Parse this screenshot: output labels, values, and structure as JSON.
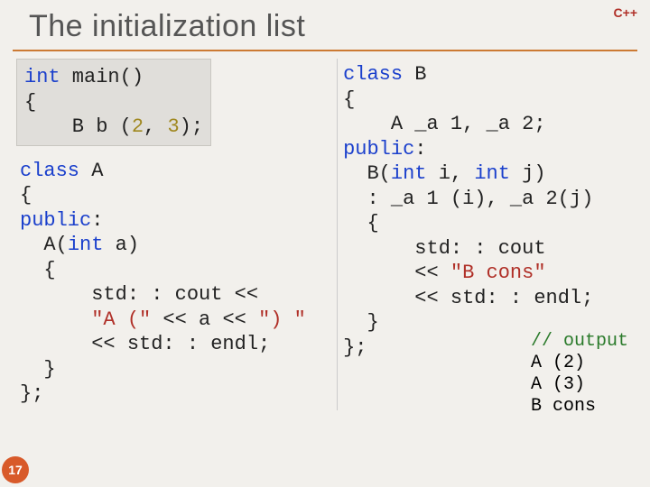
{
  "corner_label": "C++",
  "title": "The initialization list",
  "page_number": "17",
  "main_block": {
    "line1_kw": "int",
    "line1_rest": " main()",
    "line2": "{",
    "line3_pre": "    B b (",
    "line3_n1": "2",
    "line3_mid": ", ",
    "line3_n2": "3",
    "line3_post": ");"
  },
  "class_a": {
    "l1_kw": "class",
    "l1_rest": " A",
    "l2": "{",
    "l3_kw": "public",
    "l3_rest": ":",
    "l4_pre": "  A(",
    "l4_kw": "int",
    "l4_rest": " a)",
    "l5": "  {",
    "l6": "      std: : cout <<",
    "l7_pre": "      ",
    "l7_str": "\"A (\"",
    "l7_mid": " << a << ",
    "l7_str2": "\") \"",
    "l8": "      << std: : endl;",
    "l9": "  }",
    "l10": "};"
  },
  "class_b": {
    "l1_kw": "class",
    "l1_rest": " B",
    "l2": "{",
    "l3": "    A _a 1, _a 2;",
    "l4_kw": "public",
    "l4_rest": ":",
    "l5_pre": "  B(",
    "l5_kw1": "int",
    "l5_mid": " i, ",
    "l5_kw2": "int",
    "l5_rest": " j)",
    "l6": "  : _a 1 (i), _a 2(j)",
    "l7": "  {",
    "l8": "      std: : cout",
    "l9_pre": "      << ",
    "l9_str": "\"B cons\"",
    "l10": "      << std: : endl;",
    "l11": "  }",
    "l12": "};"
  },
  "output": {
    "comment": "// output",
    "l1": "A (2)",
    "l2": "A (3)",
    "l3": "B cons"
  }
}
